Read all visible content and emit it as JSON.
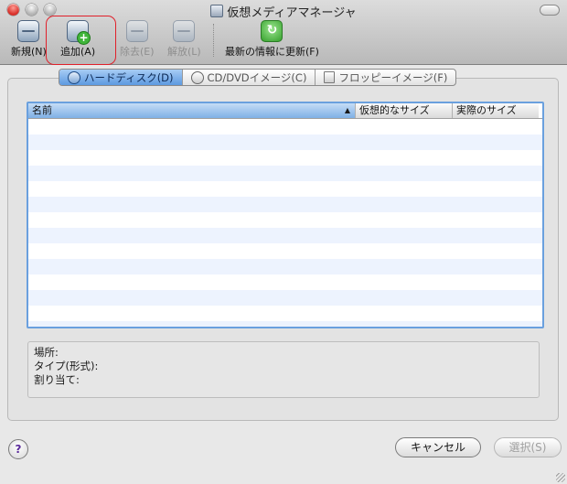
{
  "window": {
    "title": "仮想メディアマネージャ"
  },
  "toolbar": {
    "new_label": "新規(N)",
    "add_label": "追加(A)",
    "remove_label": "除去(E)",
    "release_label": "解放(L)",
    "refresh_label": "最新の情報に更新(F)"
  },
  "tabs": {
    "hard_disk": "ハードディスク(D)",
    "cd_dvd": "CD/DVDイメージ(C)",
    "floppy": "フロッピーイメージ(F)",
    "selected": "hard_disk"
  },
  "table": {
    "columns": [
      "名前",
      "仮想的なサイズ",
      "実際のサイズ"
    ],
    "rows": []
  },
  "info": {
    "location": "場所:",
    "type": "タイプ(形式):",
    "attached": "割り当て:"
  },
  "buttons": {
    "help": "?",
    "cancel": "キャンセル",
    "select": "選択(S)"
  },
  "colors": {
    "accent": "#6aa0de",
    "highlight_ring": "#e0202a",
    "row_alt": "#edf3fe"
  }
}
